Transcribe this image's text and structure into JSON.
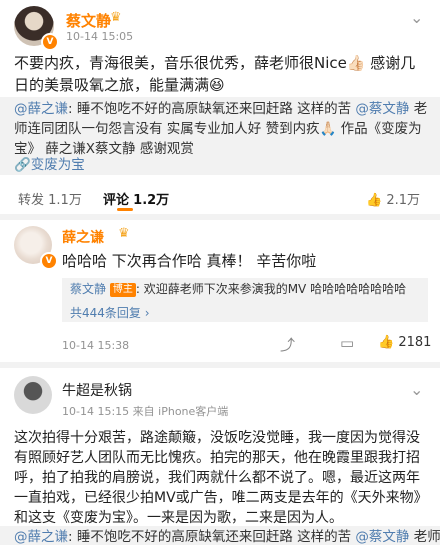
{
  "post": {
    "author": "蔡文静",
    "time": "10-14 15:05",
    "menu": "⌄",
    "text": "不要内疚，青海很美，音乐很优秀，薛老师很Nice👍🏻 感谢几日的美景吸氧之旅，能量满满😆",
    "quote": {
      "mention1": "@薛之谦",
      "part1": ": 睡不饱吃不好的高原缺氧还来回赶路 这样的苦 ",
      "mention2": "@蔡文静",
      "part2": " 老师连同团队一句怨言没有 实属专业加人好 赞到内疚🙏🏻 作品《变废为宝》 薛之谦X蔡文静 感谢观赏",
      "link": "🔗变废为宝"
    }
  },
  "stats": {
    "repost_label": "转发",
    "repost_count": "1.1万",
    "comment_label": "评论",
    "comment_count": "1.2万",
    "like_icon": "thumb-icon",
    "like_count": "2.1万"
  },
  "comment1": {
    "author": "薛之谦",
    "text": "哈哈哈 下次再合作哈 真棒！ 辛苦你啦",
    "reply_author": "蔡文静",
    "reply_tag": "博主",
    "reply_text": ": 欢迎薛老师下次来参演我的MV 哈哈哈哈哈哈哈哈",
    "reply_count": "共444条回复",
    "time": "10-14 15:38",
    "like_count": "2181"
  },
  "comment2": {
    "author": "牛超是秋锅",
    "time": "10-14 15:15 来自 iPhone客户端",
    "text": "这次拍得十分艰苦，路途颠簸，没饭吃没觉睡，我一度因为觉得没有照顾好艺人团队而无比愧疚。拍完的那天，他在晚霞里跟我打招呼，拍了拍我的肩膀说，我们两就什么都不说了。嗯，最近这两年一直拍戏，已经很少拍MV或广告，唯二两支是去年的《天外来物》和这支《变废为宝》。一来是因为歌，二来是因为人。",
    "quote_mention1": "@薛之谦",
    "quote_part1": ": 睡不饱吃不好的高原缺氧还来回赶路 这样的苦 ",
    "quote_mention2": "@蔡文静",
    "quote_part2": " 老师"
  },
  "colors": {
    "name_orange": "#ff8200",
    "link_blue": "#507daf",
    "quote_bg": "#f2f2f2"
  }
}
